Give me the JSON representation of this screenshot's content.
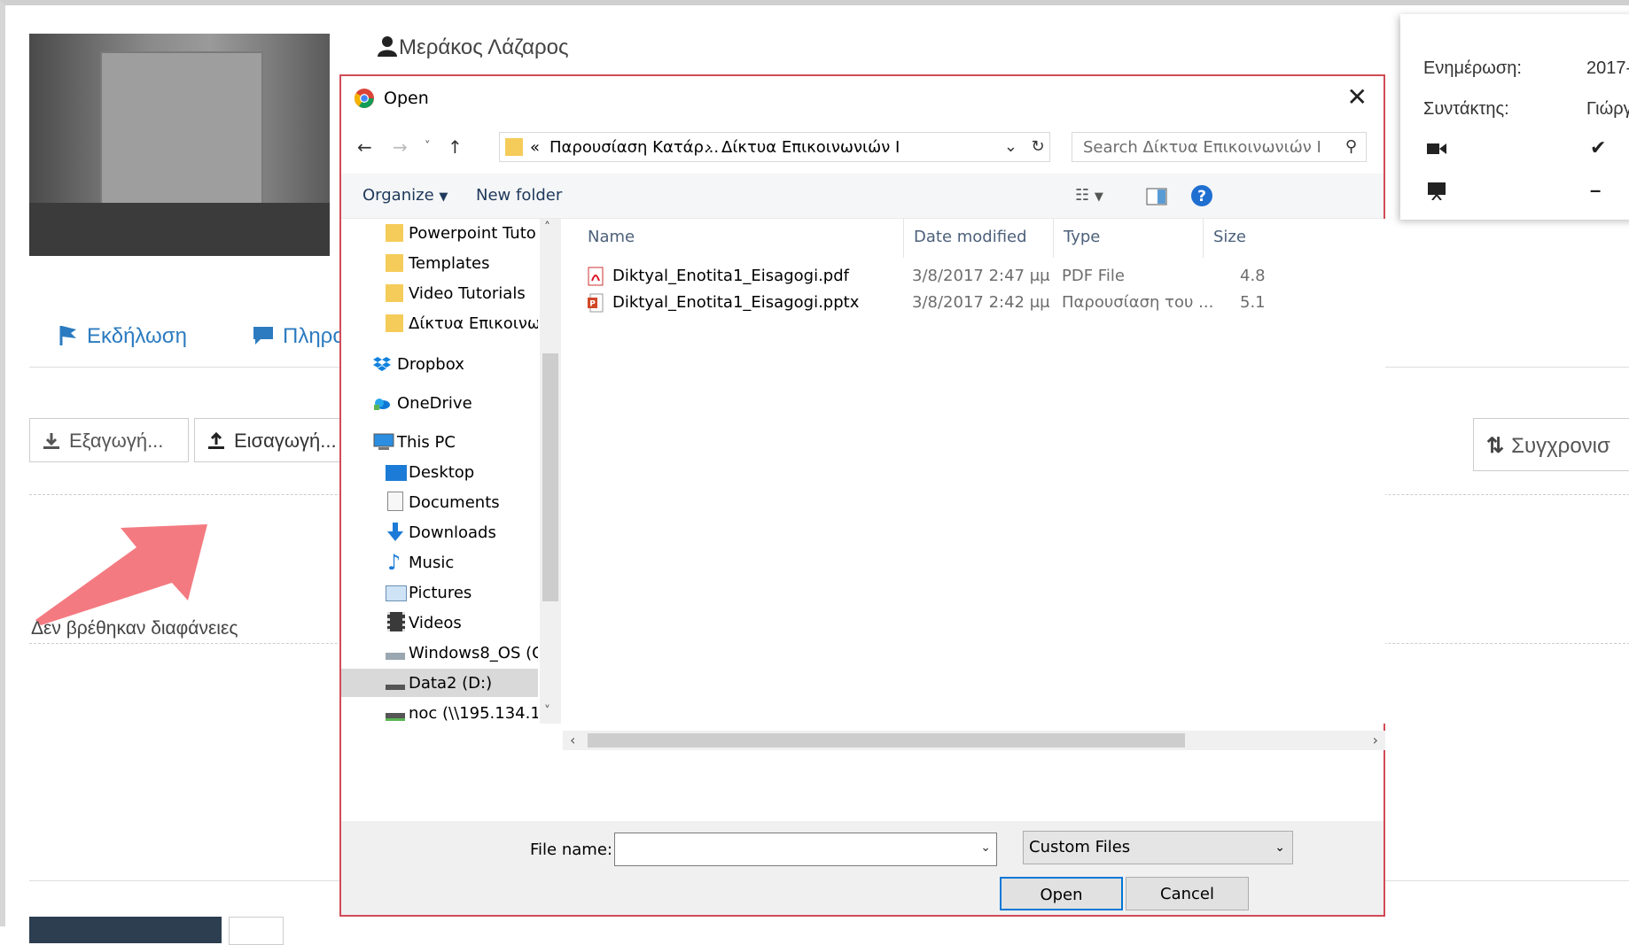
{
  "background": {
    "user_name": "Μεράκος Λάζαρος",
    "info": {
      "updated_label": "Ενημέρωση:",
      "updated_value": "2017-",
      "author_label": "Συντάκτης:",
      "author_value": "Γιώργ"
    },
    "tabs": [
      "Εκδήλωση",
      "Πληρο"
    ],
    "buttons": {
      "export": "Εξαγωγή...",
      "import": "Εισαγωγή...",
      "sync": "Συγχρονισ"
    },
    "empty_message": "Δεν βρέθηκαν διαφάνειες"
  },
  "dialog": {
    "title": "Open",
    "address": {
      "prefix": "«",
      "crumb1": "Παρουσίαση Κατάρ...",
      "sep": "›",
      "crumb2": "Δίκτυα Επικοινωνιών Ι"
    },
    "search_placeholder": "Search Δίκτυα Επικοινωνιών Ι",
    "toolbar": {
      "organize": "Organize",
      "new_folder": "New folder"
    },
    "nav_items": [
      {
        "label": "Powerpoint Tuto",
        "icon": "folder-icon"
      },
      {
        "label": "Templates",
        "icon": "folder-icon"
      },
      {
        "label": "Video Tutorials",
        "icon": "folder-icon"
      },
      {
        "label": "Δίκτυα Επικοινω",
        "icon": "folder-icon"
      },
      {
        "label": "Dropbox",
        "icon": "dropbox-icon"
      },
      {
        "label": "OneDrive",
        "icon": "onedrive-icon"
      },
      {
        "label": "This PC",
        "icon": "pc-icon"
      },
      {
        "label": "Desktop",
        "icon": "desktop-icon"
      },
      {
        "label": "Documents",
        "icon": "documents-icon"
      },
      {
        "label": "Downloads",
        "icon": "downloads-icon"
      },
      {
        "label": "Music",
        "icon": "music-icon"
      },
      {
        "label": "Pictures",
        "icon": "pictures-icon"
      },
      {
        "label": "Videos",
        "icon": "videos-icon"
      },
      {
        "label": "Windows8_OS (C",
        "icon": "drive-icon"
      },
      {
        "label": "Data2 (D:)",
        "icon": "drive-icon",
        "selected": true
      },
      {
        "label": "noc (\\\\195.134.1(",
        "icon": "network-drive-icon"
      }
    ],
    "columns": {
      "name": "Name",
      "date": "Date modified",
      "type": "Type",
      "size": "Size"
    },
    "files": [
      {
        "name": "Diktyal_Enotita1_Eisagogi.pdf",
        "date": "3/8/2017 2:47 μμ",
        "type": "PDF File",
        "size": "4.8",
        "icon": "pdf-icon"
      },
      {
        "name": "Diktyal_Enotita1_Eisagogi.pptx",
        "date": "3/8/2017 2:42 μμ",
        "type": "Παρουσίαση του ...",
        "size": "5.1",
        "icon": "pptx-icon"
      }
    ],
    "file_name_label": "File name:",
    "file_name_value": "",
    "file_type": "Custom Files",
    "open_label": "Open",
    "cancel_label": "Cancel"
  }
}
